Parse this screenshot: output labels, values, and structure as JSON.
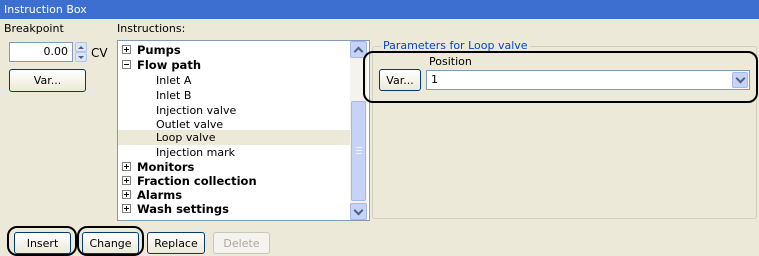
{
  "window": {
    "title": "Instruction Box"
  },
  "breakpoint": {
    "label": "Breakpoint",
    "value": "0.00",
    "unit": "CV",
    "var_button": "Var..."
  },
  "instructions": {
    "label": "Instructions:",
    "items": [
      {
        "label": "Pumps",
        "level": 0,
        "bold": true,
        "expander": "plus"
      },
      {
        "label": "Flow path",
        "level": 0,
        "bold": true,
        "expander": "minus"
      },
      {
        "label": "Inlet A",
        "level": 1
      },
      {
        "label": "Inlet B",
        "level": 1
      },
      {
        "label": "Injection valve",
        "level": 1
      },
      {
        "label": "Outlet valve",
        "level": 1
      },
      {
        "label": "Loop valve",
        "level": 1,
        "selected": true
      },
      {
        "label": "Injection mark",
        "level": 1
      },
      {
        "label": "Monitors",
        "level": 0,
        "bold": true,
        "expander": "plus"
      },
      {
        "label": "Fraction collection",
        "level": 0,
        "bold": true,
        "expander": "plus"
      },
      {
        "label": "Alarms",
        "level": 0,
        "bold": true,
        "expander": "plus"
      },
      {
        "label": "Wash settings",
        "level": 0,
        "bold": true,
        "expander": "plus"
      }
    ]
  },
  "parameters": {
    "title": "Parameters for Loop valve",
    "var_button": "Var...",
    "position_label": "Position",
    "position_value": "1"
  },
  "actions": {
    "insert": "Insert",
    "change": "Change",
    "replace": "Replace",
    "delete": "Delete"
  },
  "colors": {
    "title_bar": "#3d6fd0",
    "group_title": "#0046d5",
    "face": "#ece9d8"
  }
}
